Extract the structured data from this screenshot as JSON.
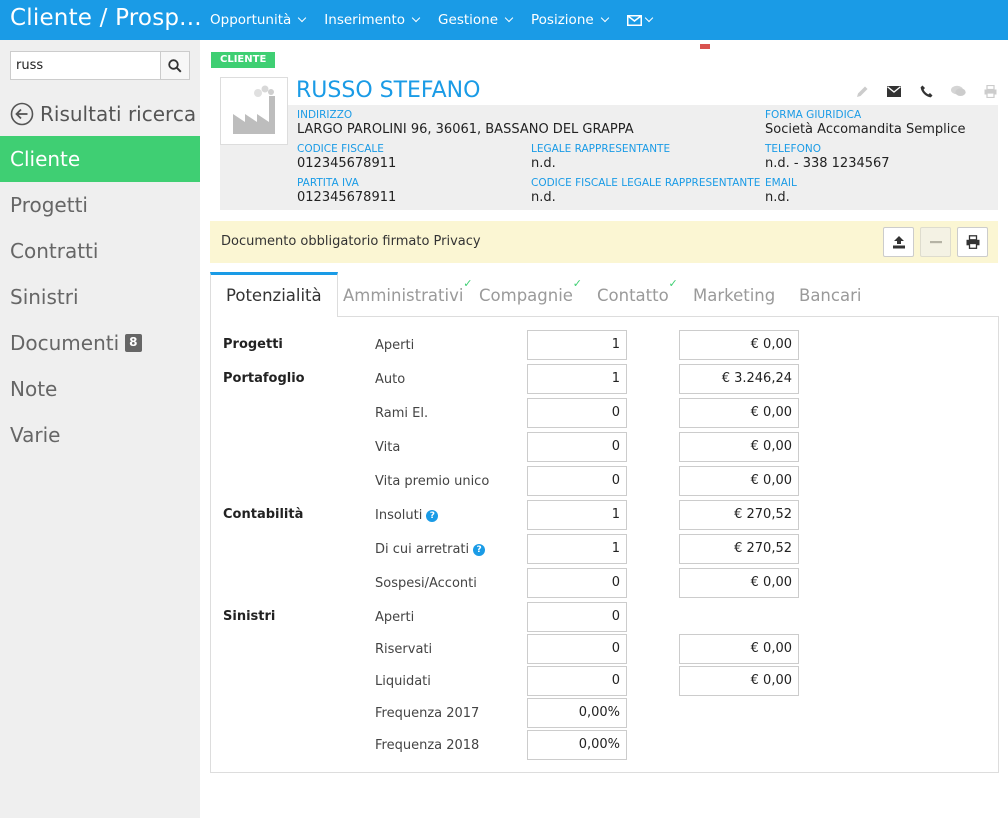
{
  "app": {
    "title": "Cliente / Prosp..."
  },
  "topnav": {
    "items": [
      {
        "label": "Opportunità"
      },
      {
        "label": "Inserimento"
      },
      {
        "label": "Gestione"
      },
      {
        "label": "Posizione"
      }
    ],
    "mail_icon": "envelope-icon"
  },
  "sidebar": {
    "search": {
      "value": "russ",
      "icon": "search-icon"
    },
    "back_label": "Risultati ricerca",
    "items": [
      {
        "label": "Cliente",
        "active": true
      },
      {
        "label": "Progetti"
      },
      {
        "label": "Contratti"
      },
      {
        "label": "Sinistri"
      },
      {
        "label": "Documenti",
        "badge": "8"
      },
      {
        "label": "Note"
      },
      {
        "label": "Varie"
      }
    ]
  },
  "client": {
    "tag": "CLIENTE",
    "name": "RUSSO STEFANO",
    "avatar_icon": "factory-icon",
    "actions": [
      "pencil-icon",
      "envelope-icon",
      "phone-icon",
      "chat-icon",
      "print-icon"
    ],
    "fields": {
      "indirizzo_label": "INDIRIZZO",
      "indirizzo": "LARGO PAROLINI 96, 36061, BASSANO DEL GRAPPA",
      "forma_label": "FORMA GIURIDICA",
      "forma": "Società Accomandita Semplice",
      "cf_label": "CODICE FISCALE",
      "cf": "012345678911",
      "legale_label": "LEGALE RAPPRESENTANTE",
      "legale": "n.d.",
      "tel_label": "TELEFONO",
      "tel": "n.d. - 338 1234567",
      "piva_label": "PARTITA IVA",
      "piva": "012345678911",
      "cf_legale_label": "CODICE FISCALE LEGALE RAPPRESENTANTE",
      "cf_legale": "n.d.",
      "email_label": "EMAIL",
      "email": "n.d."
    }
  },
  "privacy": {
    "text": "Documento obbligatorio firmato Privacy",
    "buttons": [
      "upload-icon",
      "minus-icon",
      "print-icon"
    ]
  },
  "tabs": [
    {
      "label": "Potenzialità",
      "active": true
    },
    {
      "label": "Amministrativi",
      "check": true
    },
    {
      "label": "Compagnie",
      "check": true
    },
    {
      "label": "Contatto",
      "check": true
    },
    {
      "label": "Marketing"
    },
    {
      "label": "Bancari"
    }
  ],
  "potenzialita": {
    "groups": {
      "progetti": "Progetti",
      "portafoglio": "Portafoglio",
      "contabilita": "Contabilità",
      "sinistri": "Sinistri"
    },
    "rows": [
      {
        "label": "Aperti",
        "count": "1",
        "amount": "€ 0,00"
      },
      {
        "label": "Auto",
        "count": "1",
        "amount": "€ 3.246,24"
      },
      {
        "label": "Rami El.",
        "count": "0",
        "amount": "€ 0,00"
      },
      {
        "label": "Vita",
        "count": "0",
        "amount": "€ 0,00"
      },
      {
        "label": "Vita premio unico",
        "count": "0",
        "amount": "€ 0,00"
      },
      {
        "label": "Insoluti",
        "count": "1",
        "amount": "€ 270,52",
        "help": "?"
      },
      {
        "label": "Di cui arretrati",
        "count": "1",
        "amount": "€ 270,52",
        "help": "?"
      },
      {
        "label": "Sospesi/Acconti",
        "count": "0",
        "amount": "€ 0,00"
      },
      {
        "label": "Aperti",
        "count": "0"
      },
      {
        "label": "Riservati",
        "count": "0",
        "amount": "€ 0,00"
      },
      {
        "label": "Liquidati",
        "count": "0",
        "amount": "€ 0,00"
      },
      {
        "label": "Frequenza 2017",
        "count": "0,00%"
      },
      {
        "label": "Frequenza 2018",
        "count": "0,00%"
      }
    ]
  }
}
